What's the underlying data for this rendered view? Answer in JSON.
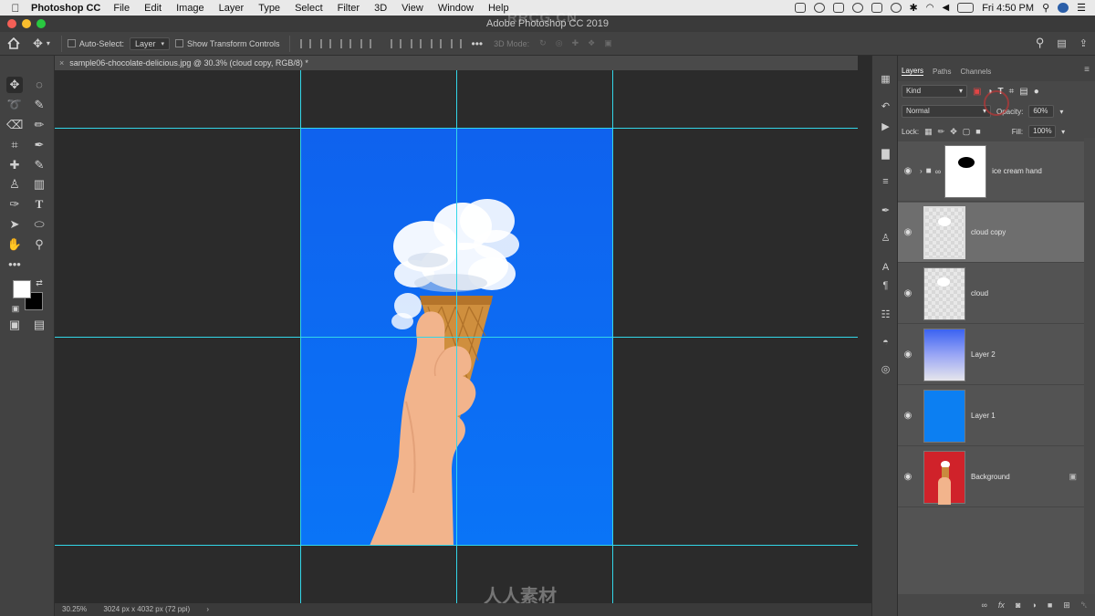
{
  "menubar": {
    "app_name": "Photoshop CC",
    "items": [
      "File",
      "Edit",
      "Image",
      "Layer",
      "Type",
      "Select",
      "Filter",
      "3D",
      "View",
      "Window",
      "Help"
    ],
    "clock": "Fri 4:50 PM"
  },
  "titlebar": {
    "title": "Adobe Photoshop CC 2019",
    "watermark": "RRCG.CN"
  },
  "options": {
    "auto_select_label": "Auto-Select:",
    "auto_select_value": "Layer",
    "show_transform_label": "Show Transform Controls",
    "mode_3d_label": "3D Mode:"
  },
  "document": {
    "tab_title": "sample06-chocolate-delicious.jpg @ 30.3% (cloud copy, RGB/8) *",
    "status_zoom": "30.25%",
    "status_info": "3024 px x 4032 px (72 ppi)"
  },
  "panel": {
    "tabs": [
      "Layers",
      "Paths",
      "Channels"
    ],
    "filter_kind": "Kind",
    "blend_mode": "Normal",
    "opacity_label": "Opacity:",
    "opacity_value": "60%",
    "lock_label": "Lock:",
    "fill_label": "Fill:",
    "fill_value": "100%"
  },
  "layers": [
    {
      "name": "ice cream hand",
      "type": "group",
      "visible": true,
      "selected": false
    },
    {
      "name": "cloud copy",
      "type": "pixel",
      "visible": true,
      "selected": true
    },
    {
      "name": "cloud",
      "type": "pixel",
      "visible": true,
      "selected": false
    },
    {
      "name": "Layer 2",
      "type": "gradient",
      "visible": true,
      "selected": false
    },
    {
      "name": "Layer 1",
      "type": "fill",
      "visible": true,
      "selected": false
    },
    {
      "name": "Background",
      "type": "image",
      "visible": true,
      "selected": false,
      "locked": true
    }
  ],
  "colors": {
    "accent_guide": "#33d6e8",
    "sky_blue": "#0a6cf5",
    "layer1_blue": "#0c7ff2",
    "background_red": "#d0222a"
  },
  "bottom_watermark": "人人素材"
}
